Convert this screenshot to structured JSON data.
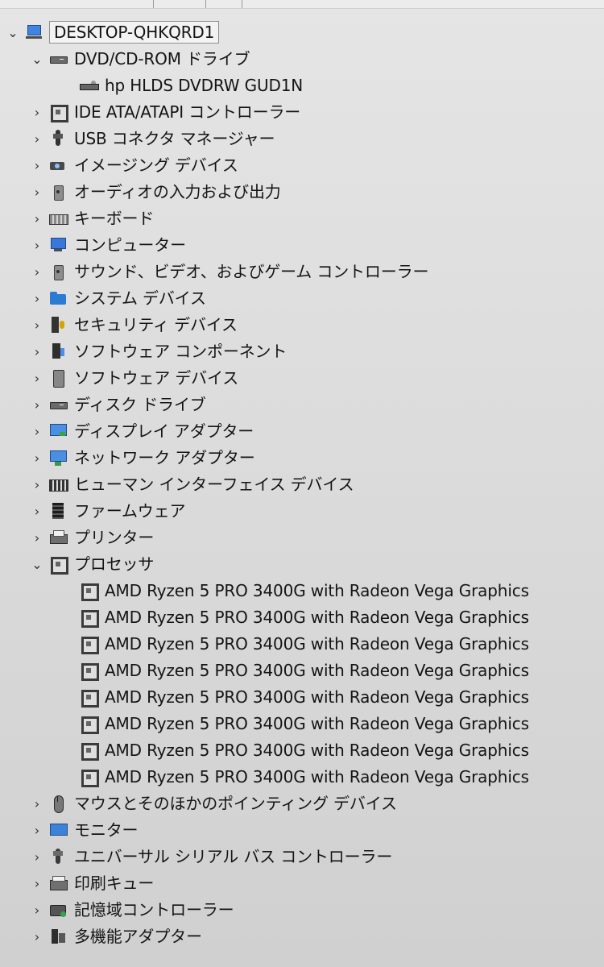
{
  "root": {
    "label": "DESKTOP-QHKQRD1",
    "expanded_icon": "chevron-down-icon",
    "collapsed_icon": "chevron-right-icon"
  },
  "groups": [
    {
      "label": "DVD/CD-ROM ドライブ",
      "icon": "dvd-drive-icon",
      "expanded": true,
      "children": [
        {
          "label": "hp HLDS DVDRW  GUD1N",
          "icon": "dvd-icon"
        }
      ]
    },
    {
      "label": "IDE ATA/ATAPI コントローラー",
      "icon": "ide-controller-icon",
      "expanded": false
    },
    {
      "label": "USB コネクタ マネージャー",
      "icon": "usb-connector-icon",
      "expanded": false
    },
    {
      "label": "イメージング デバイス",
      "icon": "camera-icon",
      "expanded": false
    },
    {
      "label": "オーディオの入力および出力",
      "icon": "speaker-icon",
      "expanded": false
    },
    {
      "label": "キーボード",
      "icon": "keyboard-icon",
      "expanded": false
    },
    {
      "label": "コンピューター",
      "icon": "computer-icon",
      "expanded": false
    },
    {
      "label": "サウンド、ビデオ、およびゲーム コントローラー",
      "icon": "speaker-icon",
      "expanded": false
    },
    {
      "label": "システム デバイス",
      "icon": "folder-icon",
      "expanded": false
    },
    {
      "label": "セキュリティ デバイス",
      "icon": "security-icon",
      "expanded": false
    },
    {
      "label": "ソフトウェア コンポーネント",
      "icon": "software-component-icon",
      "expanded": false
    },
    {
      "label": "ソフトウェア デバイス",
      "icon": "software-device-icon",
      "expanded": false
    },
    {
      "label": "ディスク ドライブ",
      "icon": "disk-drive-icon",
      "expanded": false
    },
    {
      "label": "ディスプレイ アダプター",
      "icon": "display-adapter-icon",
      "expanded": false
    },
    {
      "label": "ネットワーク アダプター",
      "icon": "network-adapter-icon",
      "expanded": false
    },
    {
      "label": "ヒューマン インターフェイス デバイス",
      "icon": "hid-icon",
      "expanded": false
    },
    {
      "label": "ファームウェア",
      "icon": "firmware-icon",
      "expanded": false
    },
    {
      "label": "プリンター",
      "icon": "printer-icon",
      "expanded": false
    },
    {
      "label": "プロセッサ",
      "icon": "processor-icon",
      "expanded": true,
      "children": [
        {
          "label": "AMD Ryzen 5 PRO 3400G with Radeon Vega Graphics",
          "icon": "processor-icon"
        },
        {
          "label": "AMD Ryzen 5 PRO 3400G with Radeon Vega Graphics",
          "icon": "processor-icon"
        },
        {
          "label": "AMD Ryzen 5 PRO 3400G with Radeon Vega Graphics",
          "icon": "processor-icon"
        },
        {
          "label": "AMD Ryzen 5 PRO 3400G with Radeon Vega Graphics",
          "icon": "processor-icon"
        },
        {
          "label": "AMD Ryzen 5 PRO 3400G with Radeon Vega Graphics",
          "icon": "processor-icon"
        },
        {
          "label": "AMD Ryzen 5 PRO 3400G with Radeon Vega Graphics",
          "icon": "processor-icon"
        },
        {
          "label": "AMD Ryzen 5 PRO 3400G with Radeon Vega Graphics",
          "icon": "processor-icon"
        },
        {
          "label": "AMD Ryzen 5 PRO 3400G with Radeon Vega Graphics",
          "icon": "processor-icon"
        }
      ]
    },
    {
      "label": "マウスとそのほかのポインティング デバイス",
      "icon": "mouse-icon",
      "expanded": false
    },
    {
      "label": "モニター",
      "icon": "monitor-icon",
      "expanded": false
    },
    {
      "label": "ユニバーサル シリアル バス コントローラー",
      "icon": "usb-controller-icon",
      "expanded": false
    },
    {
      "label": "印刷キュー",
      "icon": "print-queue-icon",
      "expanded": false
    },
    {
      "label": "記憶域コントローラー",
      "icon": "storage-controller-icon",
      "expanded": false
    },
    {
      "label": "多機能アダプター",
      "icon": "multifunction-adapter-icon",
      "expanded": false
    }
  ]
}
